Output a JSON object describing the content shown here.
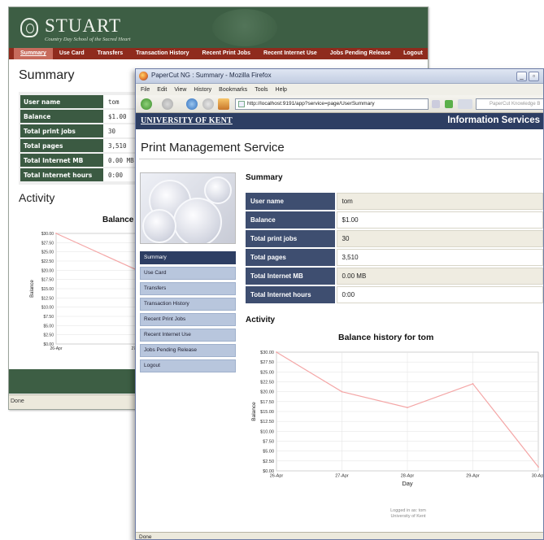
{
  "back_window": {
    "brand": "STUART",
    "subtitle": "Country Day School of the Sacred Heart",
    "nav": [
      "Summary",
      "Use Card",
      "Transfers",
      "Transaction History",
      "Recent Print Jobs",
      "Recent Internet Use",
      "Jobs Pending Release",
      "Logout"
    ],
    "nav_active": "Summary",
    "heading": "Summary",
    "rows": [
      {
        "label": "User name",
        "value": "tom"
      },
      {
        "label": "Balance",
        "value": "$1.00"
      },
      {
        "label": "Total print jobs",
        "value": "30"
      },
      {
        "label": "Total pages",
        "value": "3,510"
      },
      {
        "label": "Total Internet MB",
        "value": "0.00 MB"
      },
      {
        "label": "Total Internet hours",
        "value": "0:00"
      }
    ],
    "activity_heading": "Activity",
    "chart_title_partial": "Balance",
    "status": "Done",
    "colors": {
      "banner": "#3d5e44",
      "nav": "#8f2b1d"
    }
  },
  "front_window": {
    "title": "PaperCut NG : Summary - Mozilla Firefox",
    "menu": [
      "File",
      "Edit",
      "View",
      "History",
      "Bookmarks",
      "Tools",
      "Help"
    ],
    "url": "http://localhost:9191/app?service=page/UserSummary",
    "search_placeholder": "PaperCut Knowledge B",
    "org": "UNIVERSITY OF KENT",
    "org_right": "Information Services",
    "app_title": "Print Management Service",
    "sidebar": [
      "Summary",
      "Use Card",
      "Transfers",
      "Transaction History",
      "Recent Print Jobs",
      "Recent Internet Use",
      "Jobs Pending Release",
      "Logout"
    ],
    "sidebar_active": "Summary",
    "summary_heading": "Summary",
    "rows": [
      {
        "label": "User name",
        "value": "tom"
      },
      {
        "label": "Balance",
        "value": "$1.00"
      },
      {
        "label": "Total print jobs",
        "value": "30"
      },
      {
        "label": "Total pages",
        "value": "3,510"
      },
      {
        "label": "Total Internet MB",
        "value": "0.00 MB"
      },
      {
        "label": "Total Internet hours",
        "value": "0:00"
      }
    ],
    "activity_heading": "Activity",
    "logged_in_as": "Logged in as:  tom",
    "logged_org": "University of Kent",
    "status": "Done",
    "colors": {
      "header": "#2d3e63",
      "table_label": "#3e4e70",
      "line": "#f4a6a6"
    }
  },
  "chart_data": {
    "type": "line",
    "title": "Balance history for tom",
    "xlabel": "Day",
    "ylabel": "Balance",
    "x_ticks": [
      "26-Apr",
      "27-Apr",
      "28-Apr",
      "29-Apr",
      "30-Apr"
    ],
    "y_ticks": [
      "$30.00",
      "$27.50",
      "$25.00",
      "$22.50",
      "$20.00",
      "$17.50",
      "$15.00",
      "$12.50",
      "$10.00",
      "$7.50",
      "$5.00",
      "$2.50",
      "$0.00"
    ],
    "ylim": [
      0,
      30
    ],
    "series": [
      {
        "x": [
          "26-Apr",
          "27-Apr",
          "28-Apr",
          "29-Apr",
          "30-Apr"
        ],
        "values": [
          30.0,
          20.0,
          16.0,
          22.0,
          1.0
        ]
      }
    ],
    "grid": true
  }
}
